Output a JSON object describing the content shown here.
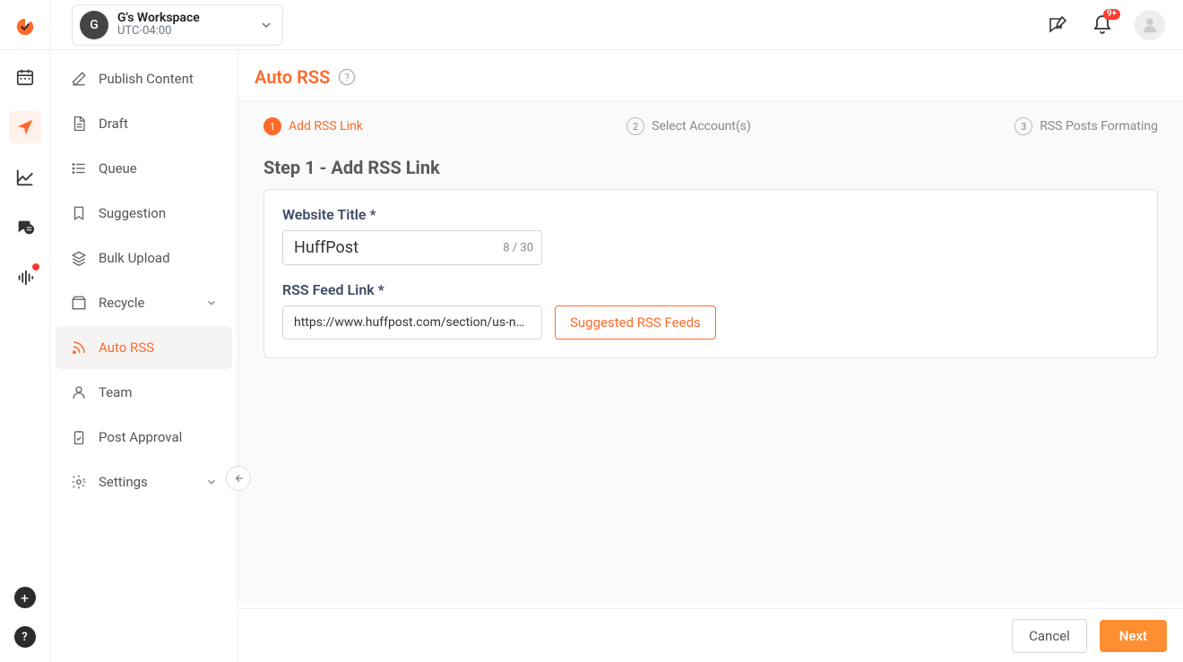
{
  "workspace": {
    "initial": "G",
    "name": "G's Workspace",
    "timezone": "UTC-04:00"
  },
  "notifications": {
    "badge": "9+"
  },
  "sidebar": {
    "items": [
      {
        "label": "Publish Content"
      },
      {
        "label": "Draft"
      },
      {
        "label": "Queue"
      },
      {
        "label": "Suggestion"
      },
      {
        "label": "Bulk Upload"
      },
      {
        "label": "Recycle"
      },
      {
        "label": "Auto RSS"
      },
      {
        "label": "Team"
      },
      {
        "label": "Post Approval"
      },
      {
        "label": "Settings"
      }
    ]
  },
  "page": {
    "title": "Auto RSS",
    "step_heading": "Step 1 - Add RSS Link"
  },
  "stepper": {
    "steps": [
      {
        "num": "1",
        "label": "Add RSS Link"
      },
      {
        "num": "2",
        "label": "Select Account(s)"
      },
      {
        "num": "3",
        "label": "RSS Posts Formating"
      }
    ]
  },
  "form": {
    "website_title_label": "Website Title *",
    "website_title_value": "HuffPost",
    "website_title_counter": "8 / 30",
    "rss_link_label": "RSS Feed Link *",
    "rss_link_value": "https://www.huffpost.com/section/us-news/fe",
    "suggested_btn": "Suggested RSS Feeds"
  },
  "footer": {
    "cancel": "Cancel",
    "next": "Next"
  }
}
